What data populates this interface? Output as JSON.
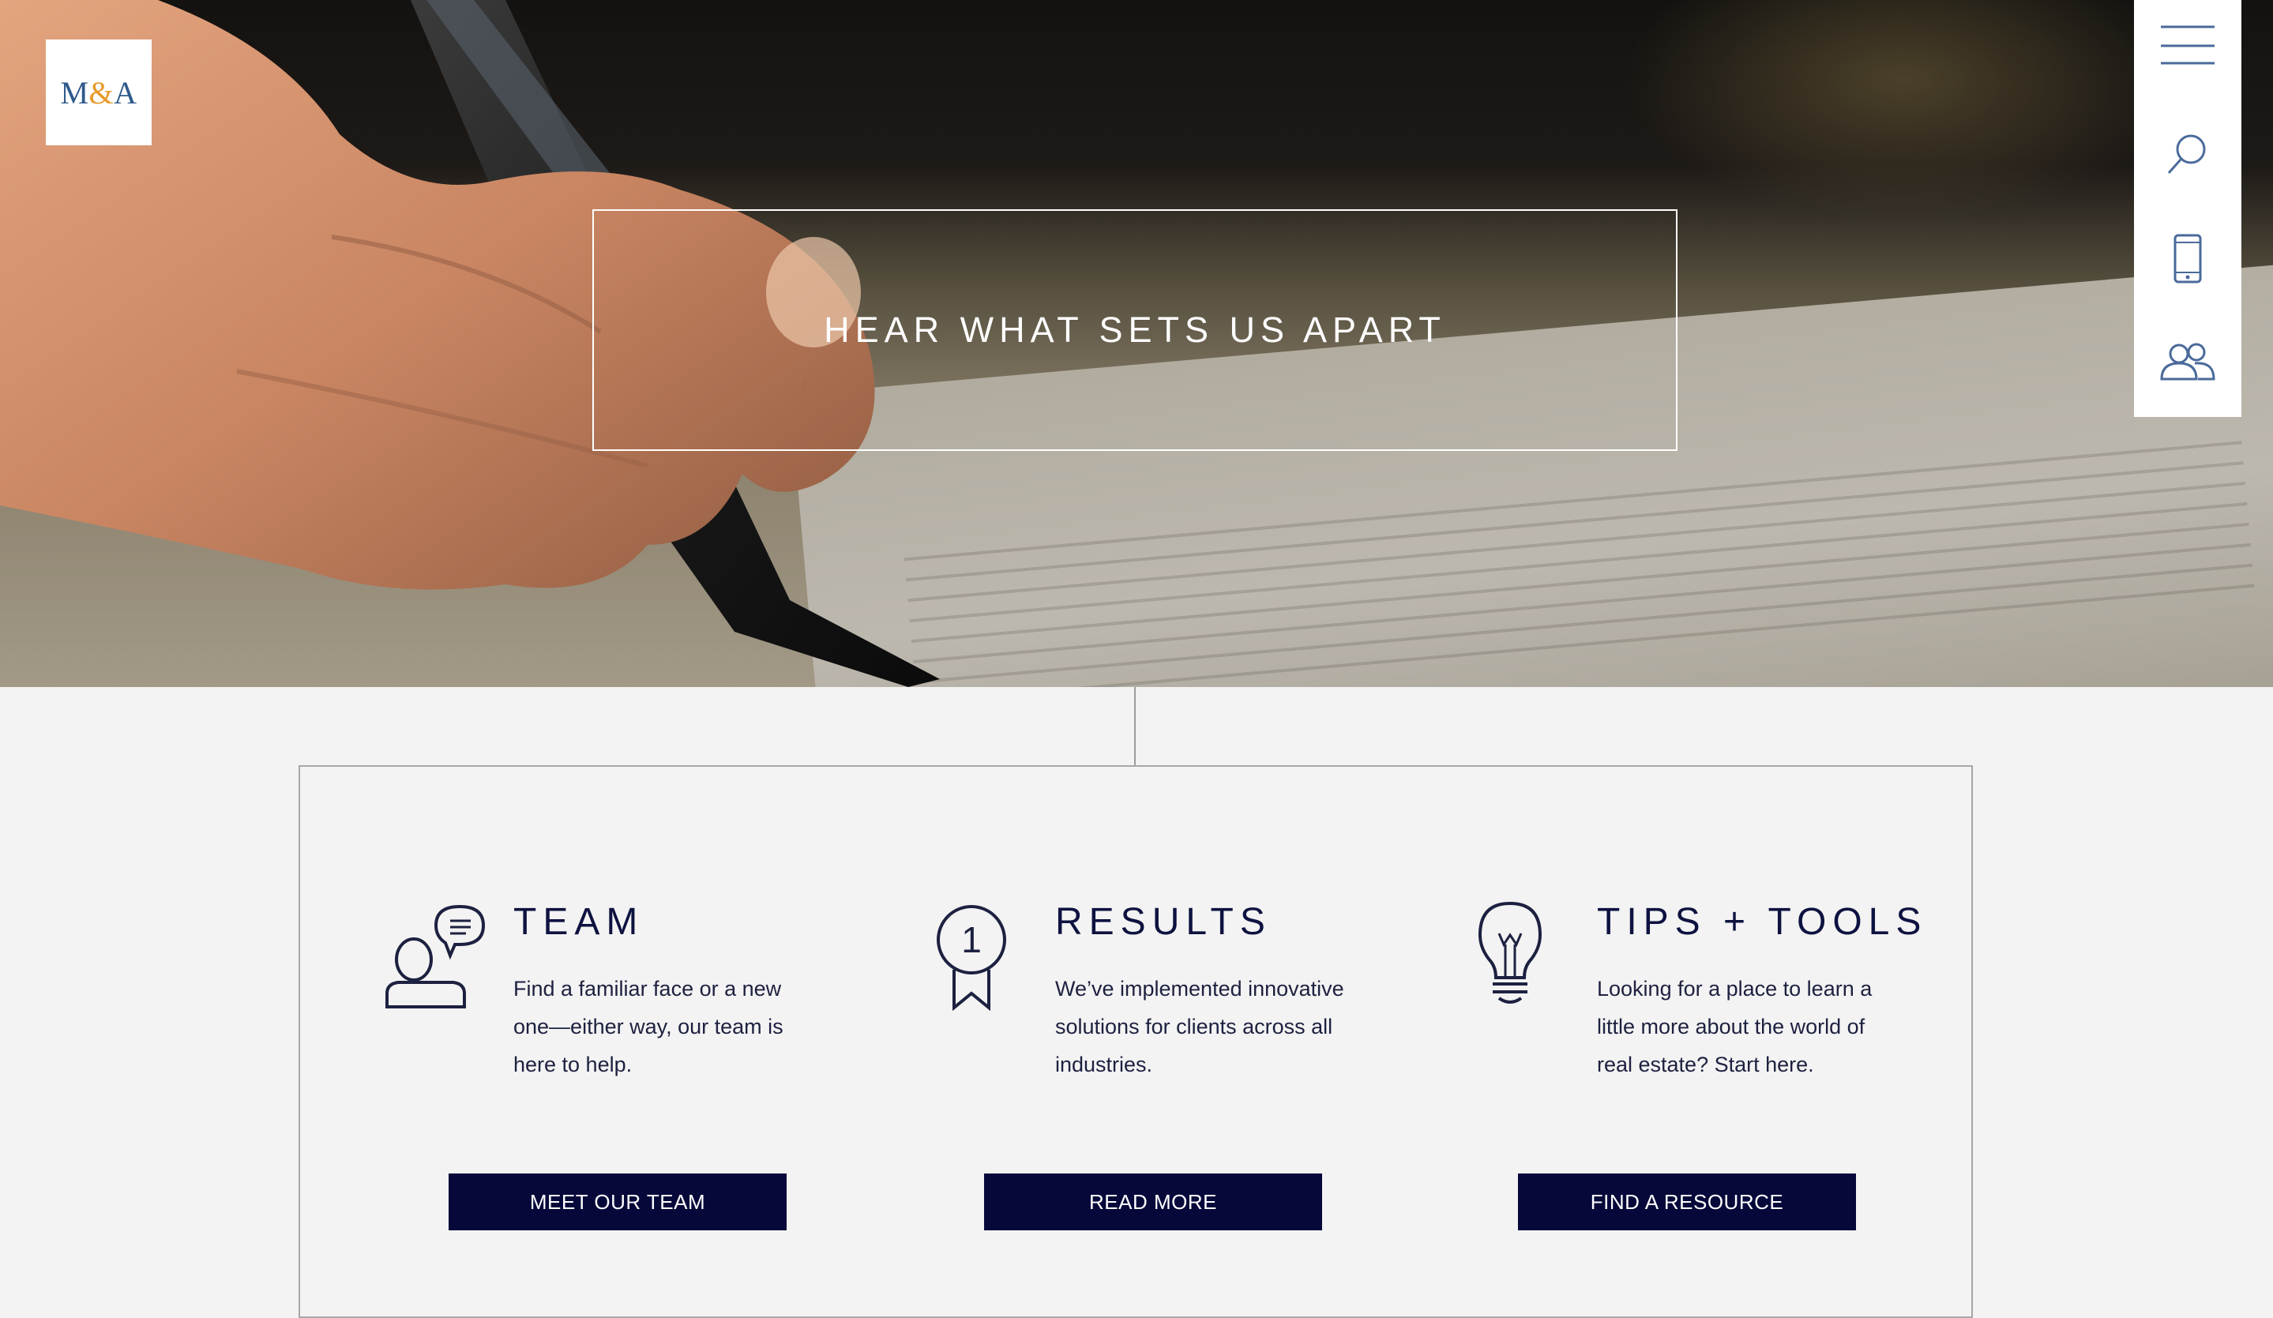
{
  "brand": {
    "logo_left": "M",
    "logo_amp": "&",
    "logo_right": "A",
    "colors": {
      "logo_blue": "#2f5a8c",
      "logo_orange": "#e89a2c",
      "navy": "#06083a",
      "icon_blue": "#4a6a9a"
    }
  },
  "hero": {
    "title": "HEAR WHAT SETS US APART",
    "image": "hand writing with pen"
  },
  "side_nav": {
    "icons": [
      "menu-icon",
      "search-icon",
      "phone-icon",
      "people-icon"
    ]
  },
  "features": [
    {
      "icon": "person-chat-icon",
      "title": "TEAM",
      "description": "Find a familiar face or a new one—either way, our team is here to help.",
      "button": "MEET OUR TEAM"
    },
    {
      "icon": "award-ribbon-icon",
      "title": "RESULTS",
      "description": "We’ve implemented innovative solutions for clients across all industries.",
      "button": "READ MORE"
    },
    {
      "icon": "lightbulb-icon",
      "title": "TIPS + TOOLS",
      "description": "Looking for a place to learn a little more about the world of real estate? Start here.",
      "button": "FIND A RESOURCE"
    }
  ]
}
